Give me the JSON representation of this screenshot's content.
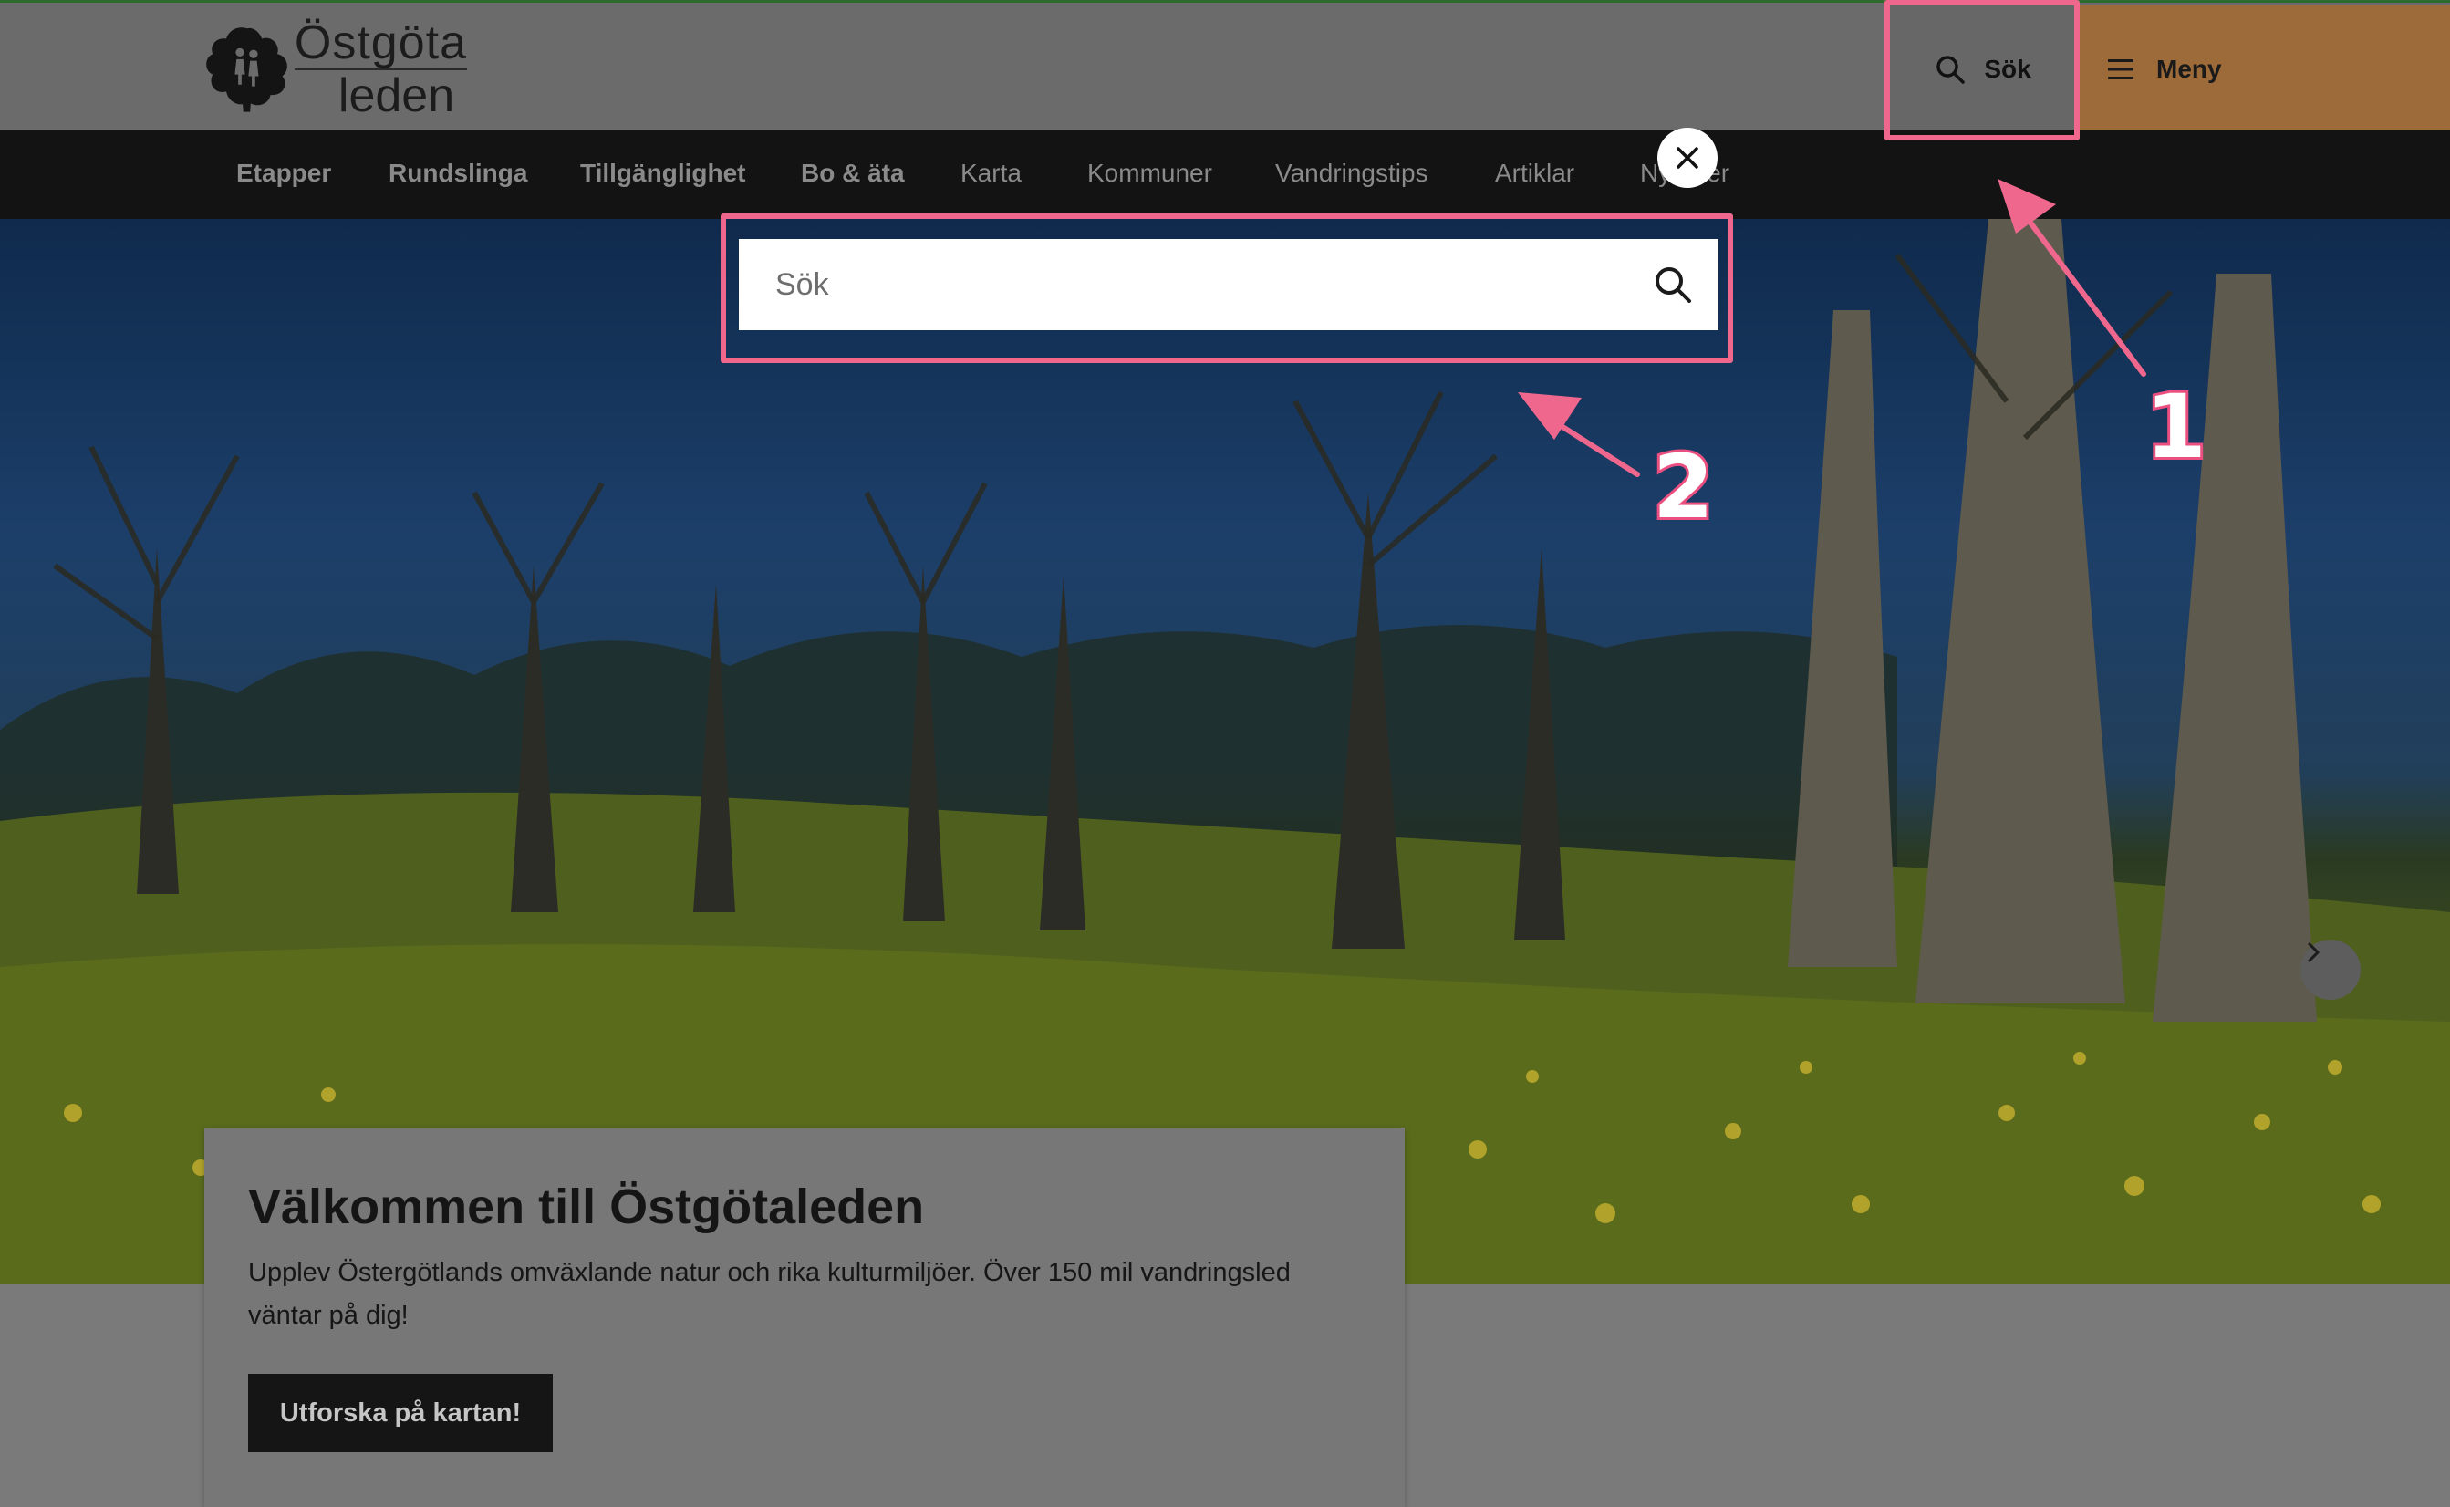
{
  "header": {
    "logo_line1": "Östgöta",
    "logo_line2": "leden",
    "search_label": "Sök",
    "menu_label": "Meny"
  },
  "nav": {
    "items": [
      "Etapper",
      "Rundslinga",
      "Tillgänglighet",
      "Bo & äta",
      "Karta",
      "Kommuner",
      "Vandringstips",
      "Artiklar",
      "Nyheter"
    ]
  },
  "search_overlay": {
    "placeholder": "Sök"
  },
  "welcome": {
    "title": "Välkommen till Östgötaleden",
    "body": "Upplev Östergötlands omväxlande natur och rika kulturmiljöer. Över 150 mil vandringsled väntar på dig!",
    "cta_label": "Utforska på kartan!"
  },
  "annotations": {
    "label_1": "1",
    "label_2": "2"
  },
  "colors": {
    "accent_menu": "#9d6a39",
    "annotation": "#f0678e",
    "nav_bg": "#131313"
  },
  "icons": {
    "search": "search-icon",
    "menu": "hamburger-icon",
    "close": "close-icon",
    "next": "chevron-right-icon"
  }
}
